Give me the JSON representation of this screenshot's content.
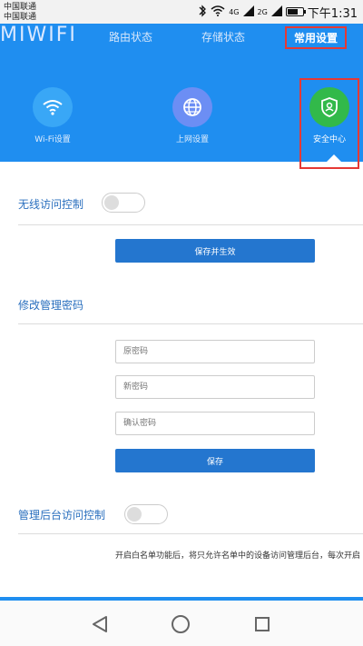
{
  "status_bar": {
    "carrier_1": "中国联通",
    "carrier_2": "中国联通",
    "net_1": "4G",
    "net_2": "2G",
    "battery_level": 0.7,
    "time": "下午1:31"
  },
  "header": {
    "logo": "MIWIFI",
    "nav": {
      "route_status": "路由状态",
      "storage_status": "存储状态",
      "common_settings": "常用设置"
    },
    "features": {
      "wifi": "Wi-Fi设置",
      "network": "上网设置",
      "security": "安全中心"
    }
  },
  "wireless_access": {
    "title": "无线访问控制",
    "enabled": false,
    "save_button": "保存并生效"
  },
  "password": {
    "title": "修改管理密码",
    "old_placeholder": "原密码",
    "new_placeholder": "新密码",
    "confirm_placeholder": "确认密码",
    "save_button": "保存"
  },
  "admin_access": {
    "title": "管理后台访问控制",
    "enabled": false,
    "note": "开启白名单功能后，将只允许名单中的设备访问管理后台，每次开启"
  },
  "colors": {
    "header_blue": "#1f8ef0",
    "button_blue": "#2476cf",
    "highlight_red": "#e53935",
    "security_green": "#32b94a"
  }
}
